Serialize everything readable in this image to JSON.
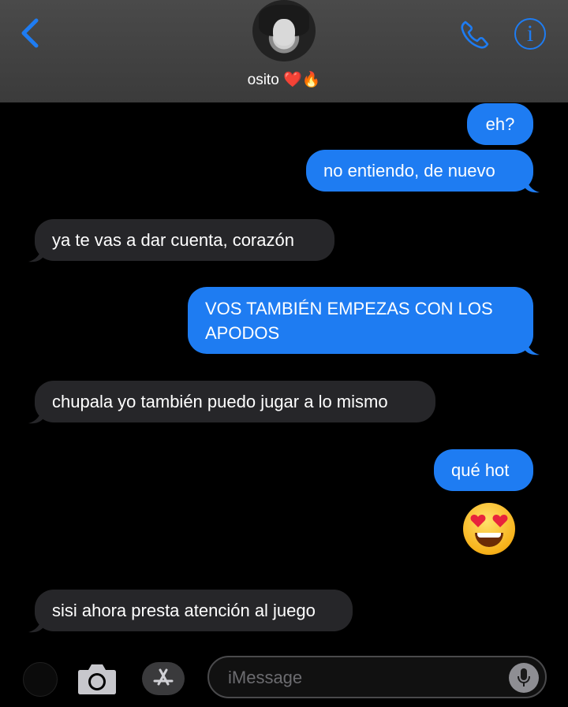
{
  "header": {
    "contact_name": "osito",
    "contact_emoji": "❤️🔥",
    "icons": [
      "chevron-left-icon",
      "phone-icon",
      "info-icon"
    ]
  },
  "messages": [
    {
      "side": "out",
      "text": "eh?"
    },
    {
      "side": "out",
      "text": "no entiendo, de nuevo"
    },
    {
      "side": "in",
      "text": "ya te vas a dar cuenta, corazón"
    },
    {
      "side": "out",
      "text": "VOS TAMBIÉN EMPEZAS CON LOS APODOS"
    },
    {
      "side": "in",
      "text": "chupala yo también puedo jugar a lo mismo"
    },
    {
      "side": "out",
      "text": "qué hot"
    },
    {
      "side": "out",
      "emoji": "😍"
    },
    {
      "side": "in",
      "text": "sisi ahora presta atención al juego"
    }
  ],
  "composer": {
    "placeholder": "iMessage",
    "icons": [
      "apps-icon",
      "camera-icon",
      "app-store-icon",
      "microphone-icon"
    ]
  },
  "colors": {
    "outgoing_bubble": "#1e7cf2",
    "incoming_bubble": "#262629",
    "accent": "#1e7cf2"
  }
}
